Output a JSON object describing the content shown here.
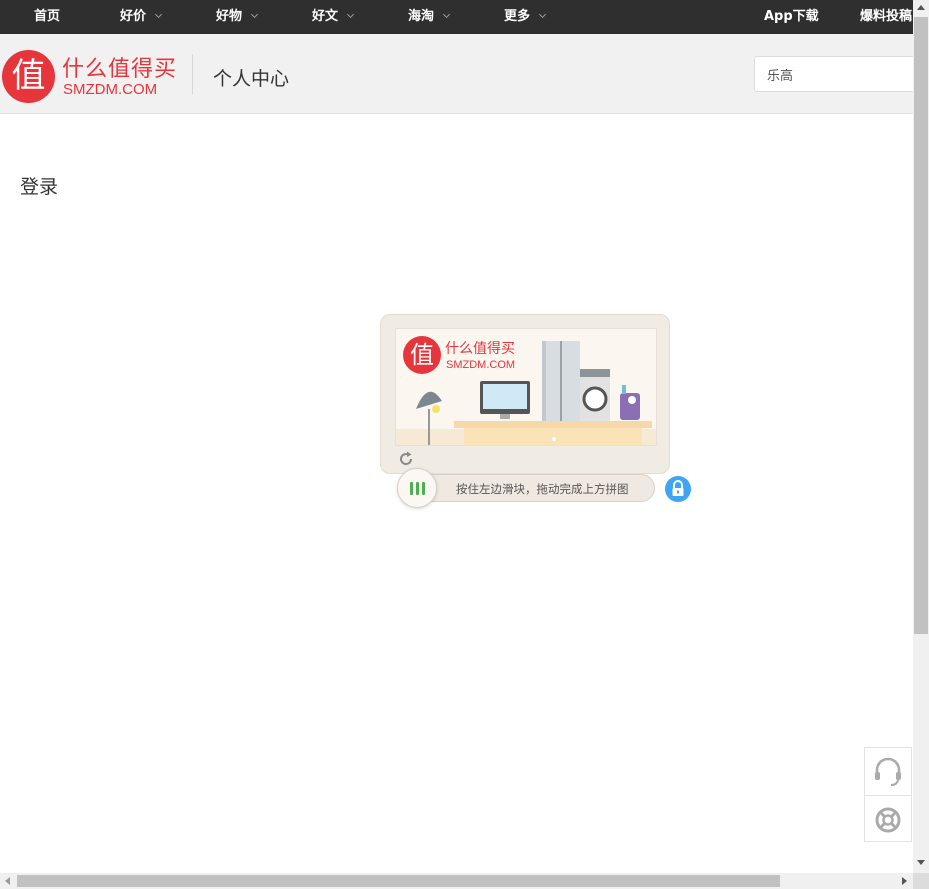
{
  "topnav": {
    "items": [
      {
        "label": "首页",
        "has_dropdown": false
      },
      {
        "label": "好价",
        "has_dropdown": true
      },
      {
        "label": "好物",
        "has_dropdown": true
      },
      {
        "label": "好文",
        "has_dropdown": true
      },
      {
        "label": "海淘",
        "has_dropdown": true
      },
      {
        "label": "更多",
        "has_dropdown": true
      }
    ],
    "app_download": "App下载",
    "submit_deal": "爆料投稿"
  },
  "header": {
    "logo_char": "值",
    "logo_cn": "什么值得买",
    "logo_en": "SMZDM.COM",
    "page_title": "个人中心",
    "search_value": "乐高"
  },
  "main": {
    "login_heading": "登录"
  },
  "captcha": {
    "image_logo_char": "值",
    "image_logo_cn": "什么值得买",
    "image_logo_en": "SMZDM.COM",
    "slider_hint": "按住左边滑块，拖动完成上方拼图",
    "slider_progress": 0,
    "refresh_icon": "refresh-icon",
    "lock_icon": "lock-icon"
  },
  "float_tools": {
    "items": [
      "headset-icon",
      "lifebuoy-icon"
    ]
  },
  "colors": {
    "nav_bg": "#2f2f2f",
    "brand_red": "#e6353b",
    "header_bg": "#f1f1f1",
    "captcha_bg": "#f0ebe3",
    "slider_green": "#4caf50",
    "lock_blue": "#3ea5f3"
  }
}
